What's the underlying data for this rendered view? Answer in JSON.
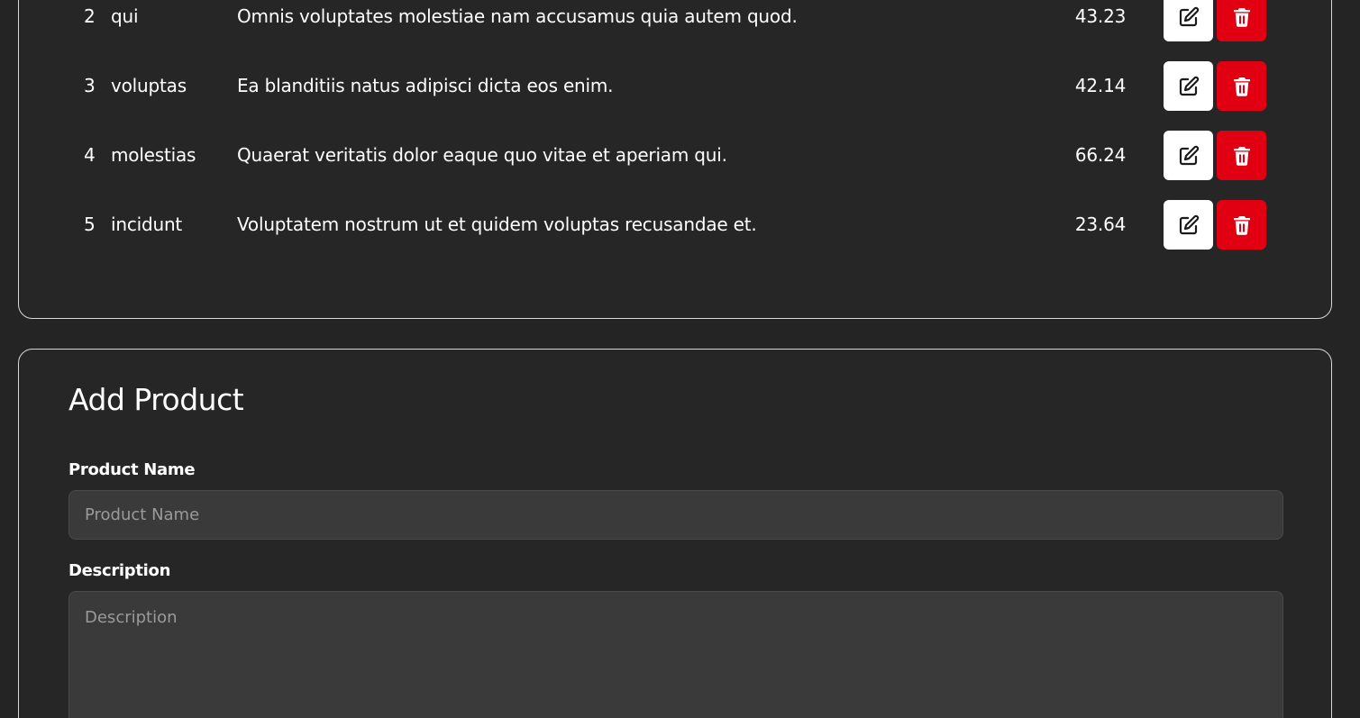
{
  "colors": {
    "background": "#242424",
    "card_border": "#d8d8d8",
    "input_background": "#3a3a3a",
    "edit_button": "#ffffff",
    "delete_button": "#e10012"
  },
  "icons": {
    "edit": "pencil-square-icon",
    "delete": "trash-icon"
  },
  "products": [
    {
      "id": "2",
      "name": "qui",
      "description": "Omnis voluptates molestiae nam accusamus quia autem quod.",
      "price": "43.23"
    },
    {
      "id": "3",
      "name": "voluptas",
      "description": "Ea blanditiis natus adipisci dicta eos enim.",
      "price": "42.14"
    },
    {
      "id": "4",
      "name": "molestias",
      "description": "Quaerat veritatis dolor eaque quo vitae et aperiam qui.",
      "price": "66.24"
    },
    {
      "id": "5",
      "name": "incidunt",
      "description": "Voluptatem nostrum ut et quidem voluptas recusandae et.",
      "price": "23.64"
    }
  ],
  "form": {
    "title": "Add Product",
    "name_label": "Product Name",
    "name_placeholder": "Product Name",
    "name_value": "",
    "description_label": "Description",
    "description_placeholder": "Description",
    "description_value": ""
  }
}
